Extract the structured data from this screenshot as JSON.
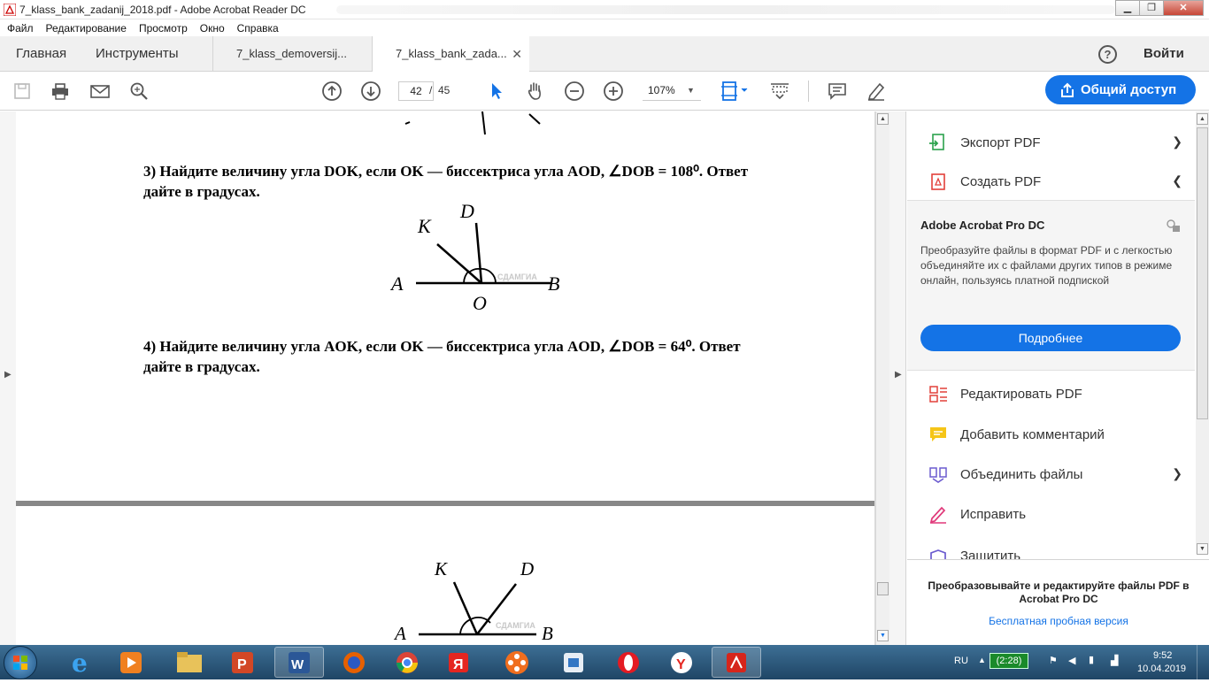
{
  "window": {
    "title": "7_klass_bank_zadanij_2018.pdf - Adobe Acrobat Reader DC"
  },
  "menu": [
    "Файл",
    "Редактирование",
    "Просмотр",
    "Окно",
    "Справка"
  ],
  "tabs": {
    "home": "Главная",
    "tools": "Инструменты",
    "doc1": "7_klass_demoversij...",
    "doc2": "7_klass_bank_zada...",
    "close": "✕",
    "help": "?",
    "signin": "Войти"
  },
  "toolbar": {
    "page_current": "42",
    "page_sep": "/",
    "page_total": "45",
    "zoom": "107%",
    "share": "Общий доступ"
  },
  "document": {
    "q3_line1": "3) Найдите величину угла DOK, если OK — биссектриса угла AOD, ∠DOB = 108⁰. Ответ",
    "q3_line2": "дайте в градусах.",
    "q4_line1": "4) Найдите величину угла AOK, если OK — биссектриса угла AOD, ∠DOB = 64⁰. Ответ",
    "q4_line2": "дайте в градусах.",
    "label_A": "A",
    "label_B": "B",
    "label_O": "O",
    "label_K": "K",
    "label_D": "D",
    "watermark": "СДАМГИА"
  },
  "rightpane": {
    "export": "Экспорт PDF",
    "create": "Создать PDF",
    "promo_title": "Adobe Acrobat Pro DC",
    "promo_text": "Преобразуйте файлы в формат PDF и с легкостью объединяйте их с файлами других типов в режиме онлайн, пользуясь платной подпиской",
    "more": "Подробнее",
    "edit": "Редактировать PDF",
    "comment": "Добавить комментарий",
    "combine": "Объединить файлы",
    "fill": "Исправить",
    "protect": "Защитить",
    "footer_text": "Преобразовывайте и редактируйте файлы PDF в Acrobat Pro DC",
    "footer_link": "Бесплатная пробная версия"
  },
  "taskbar": {
    "lang": "RU",
    "battery": "(2:28)",
    "time": "9:52",
    "date": "10.04.2019"
  },
  "colors": {
    "accent": "#1473e6",
    "taskbar": "#2b5677"
  }
}
